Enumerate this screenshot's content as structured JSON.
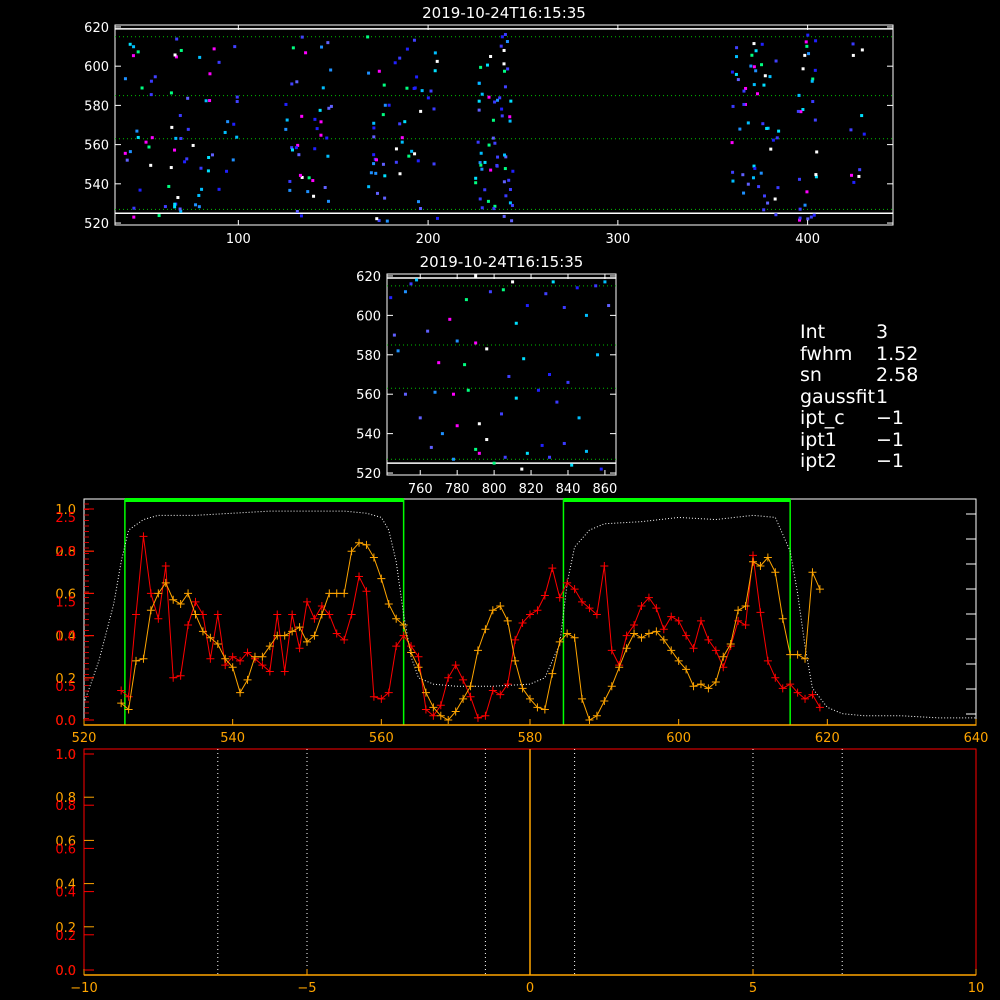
{
  "colors": {
    "axis_white": "#ffffff",
    "axis_orange": "#ffa500",
    "axis_red": "#ff0000",
    "range_green": "#00ff00",
    "grid_green": "#00c000",
    "curve_white": "#ffffff"
  },
  "info_panel": {
    "rows": [
      {
        "label": "Int",
        "value": "3"
      },
      {
        "label": "fwhm",
        "value": "1.52"
      },
      {
        "label": "sn",
        "value": "2.58"
      },
      {
        "label": "gaussfit",
        "value": "1"
      },
      {
        "label": "ipt_c",
        "value": "−1"
      },
      {
        "label": "ipt1",
        "value": "−1"
      },
      {
        "label": "ipt2",
        "value": "−1"
      }
    ]
  },
  "chart_data": [
    {
      "type": "heatmap",
      "title": "2019-10-24T16:15:35",
      "xlim": [
        35,
        445
      ],
      "ylim": [
        519,
        621
      ],
      "xticks": [
        100,
        200,
        300,
        400
      ],
      "yticks": [
        520,
        540,
        560,
        580,
        600,
        620
      ],
      "hlines_white": [
        525,
        619
      ],
      "hlines_green_dotted": [
        527,
        563,
        585,
        615
      ],
      "point_clusters": [
        {
          "x_range": [
            40,
            100
          ],
          "y_range": [
            521,
            617
          ],
          "count": 70
        },
        {
          "x_range": [
            125,
            150
          ],
          "y_range": [
            521,
            617
          ],
          "count": 40
        },
        {
          "x_range": [
            168,
            205
          ],
          "y_range": [
            521,
            617
          ],
          "count": 55
        },
        {
          "x_range": [
            225,
            245
          ],
          "y_range": [
            521,
            617
          ],
          "count": 60
        },
        {
          "x_range": [
            360,
            385
          ],
          "y_range": [
            521,
            617
          ],
          "count": 50
        },
        {
          "x_range": [
            395,
            405
          ],
          "y_range": [
            521,
            617
          ],
          "count": 28
        },
        {
          "x_range": [
            422,
            430
          ],
          "y_range": [
            521,
            617
          ],
          "count": 10
        }
      ]
    },
    {
      "type": "heatmap",
      "title": "2019-10-24T16:15:35",
      "xlim": [
        742,
        866
      ],
      "ylim": [
        519,
        621
      ],
      "xticks": [
        760,
        780,
        800,
        820,
        840,
        860
      ],
      "yticks": [
        520,
        540,
        560,
        580,
        600,
        620
      ],
      "hlines_white": [
        525,
        619
      ],
      "hlines_green_dotted": [
        527,
        563,
        585,
        615
      ],
      "points": [
        [
          744,
          609
        ],
        [
          755,
          616
        ],
        [
          758,
          618
        ],
        [
          764,
          592
        ],
        [
          780,
          587
        ],
        [
          790,
          586
        ],
        [
          805,
          613
        ],
        [
          810,
          617
        ],
        [
          828,
          611
        ],
        [
          832,
          617
        ],
        [
          845,
          614
        ],
        [
          855,
          615
        ],
        [
          860,
          617
        ],
        [
          746,
          590
        ],
        [
          752,
          612
        ],
        [
          776,
          598
        ],
        [
          785,
          608
        ],
        [
          790,
          620
        ],
        [
          798,
          612
        ],
        [
          812,
          596
        ],
        [
          818,
          605
        ],
        [
          838,
          604
        ],
        [
          850,
          600
        ],
        [
          862,
          605
        ],
        [
          748,
          582
        ],
        [
          770,
          576
        ],
        [
          784,
          575
        ],
        [
          796,
          583
        ],
        [
          808,
          569
        ],
        [
          816,
          578
        ],
        [
          830,
          570
        ],
        [
          840,
          566
        ],
        [
          856,
          580
        ],
        [
          752,
          560
        ],
        [
          768,
          561
        ],
        [
          778,
          560
        ],
        [
          786,
          562
        ],
        [
          792,
          545
        ],
        [
          804,
          550
        ],
        [
          812,
          558
        ],
        [
          824,
          562
        ],
        [
          834,
          556
        ],
        [
          846,
          548
        ],
        [
          760,
          548
        ],
        [
          772,
          540
        ],
        [
          780,
          544
        ],
        [
          790,
          532
        ],
        [
          796,
          537
        ],
        [
          806,
          528
        ],
        [
          818,
          530
        ],
        [
          826,
          534
        ],
        [
          838,
          535
        ],
        [
          850,
          531
        ],
        [
          766,
          533
        ],
        [
          778,
          527
        ],
        [
          792,
          530
        ],
        [
          800,
          525
        ],
        [
          815,
          522
        ],
        [
          830,
          528
        ],
        [
          842,
          524
        ],
        [
          858,
          522
        ]
      ]
    },
    {
      "type": "line",
      "xlim": [
        520,
        640
      ],
      "xticks": [
        520,
        540,
        560,
        580,
        600,
        620,
        640
      ],
      "yaxes": [
        {
          "color": "#ffa500",
          "ticks": [
            "0.0",
            "0.2",
            "0.4",
            "0.6",
            "0.8",
            "1.0"
          ]
        },
        {
          "color": "#ff0000",
          "ticks": [
            "0.0",
            "0.5",
            "1.0",
            "1.5",
            "2.0",
            "2.5"
          ]
        }
      ],
      "green_ranges": [
        [
          525.5,
          563
        ],
        [
          584.5,
          615
        ]
      ],
      "series": [
        {
          "color": "#ff0000",
          "marker": "plus",
          "x": [
            525,
            526,
            527,
            528,
            529,
            530,
            531,
            532,
            533,
            534,
            535,
            536,
            537,
            538,
            539,
            540,
            541,
            542,
            543,
            544,
            545,
            546,
            547,
            548,
            549,
            550,
            551,
            552,
            553,
            554,
            555,
            556,
            557,
            558,
            559,
            560,
            561,
            562,
            563,
            564,
            565,
            566,
            567,
            568,
            569,
            570,
            571,
            572,
            573,
            574,
            575,
            576,
            577,
            578,
            579,
            580,
            581,
            582,
            583,
            584,
            585,
            586,
            587,
            588,
            589,
            590,
            591,
            592,
            593,
            594,
            595,
            596,
            597,
            598,
            599,
            600,
            601,
            602,
            603,
            604,
            605,
            606,
            607,
            608,
            609,
            610,
            611,
            612,
            613,
            614,
            615,
            616,
            617,
            618,
            619
          ],
          "y": [
            0.14,
            0.11,
            0.5,
            0.87,
            0.6,
            0.48,
            0.73,
            0.2,
            0.21,
            0.45,
            0.56,
            0.5,
            0.29,
            0.5,
            0.26,
            0.3,
            0.28,
            0.32,
            0.29,
            0.26,
            0.23,
            0.5,
            0.23,
            0.5,
            0.34,
            0.56,
            0.48,
            0.54,
            0.5,
            0.41,
            0.38,
            0.5,
            0.68,
            0.61,
            0.11,
            0.1,
            0.13,
            0.35,
            0.4,
            0.35,
            0.3,
            0.05,
            0.02,
            0.07,
            0.2,
            0.26,
            0.19,
            0.11,
            0.01,
            0.02,
            0.14,
            0.12,
            0.17,
            0.38,
            0.46,
            0.5,
            0.52,
            0.59,
            0.72,
            0.58,
            0.65,
            0.62,
            0.56,
            0.53,
            0.5,
            0.73,
            0.33,
            0.26,
            0.4,
            0.45,
            0.54,
            0.58,
            0.53,
            0.43,
            0.49,
            0.47,
            0.4,
            0.34,
            0.47,
            0.38,
            0.33,
            0.25,
            0.35,
            0.47,
            0.45,
            0.78,
            0.51,
            0.28,
            0.2,
            0.15,
            0.17,
            0.13,
            0.1,
            0.12,
            0.06
          ]
        },
        {
          "color": "#ffa500",
          "marker": "plus",
          "x": [
            525,
            526,
            527,
            528,
            529,
            530,
            531,
            532,
            533,
            534,
            535,
            536,
            537,
            538,
            539,
            540,
            541,
            542,
            543,
            544,
            545,
            546,
            547,
            548,
            549,
            550,
            551,
            552,
            553,
            554,
            555,
            556,
            557,
            558,
            559,
            560,
            561,
            562,
            563,
            564,
            565,
            566,
            567,
            568,
            569,
            570,
            571,
            572,
            573,
            574,
            575,
            576,
            577,
            578,
            579,
            580,
            581,
            582,
            583,
            584,
            585,
            586,
            587,
            588,
            589,
            590,
            591,
            592,
            593,
            594,
            595,
            596,
            597,
            598,
            599,
            600,
            601,
            602,
            603,
            604,
            605,
            606,
            607,
            608,
            609,
            610,
            611,
            612,
            613,
            614,
            615,
            616,
            617,
            618,
            619
          ],
          "y": [
            0.08,
            0.05,
            0.28,
            0.29,
            0.52,
            0.6,
            0.65,
            0.57,
            0.55,
            0.6,
            0.5,
            0.42,
            0.39,
            0.36,
            0.29,
            0.25,
            0.13,
            0.19,
            0.3,
            0.3,
            0.35,
            0.4,
            0.4,
            0.42,
            0.44,
            0.37,
            0.4,
            0.5,
            0.6,
            0.6,
            0.6,
            0.8,
            0.84,
            0.83,
            0.77,
            0.67,
            0.55,
            0.48,
            0.45,
            0.32,
            0.25,
            0.13,
            0.06,
            0.02,
            0.0,
            0.04,
            0.1,
            0.16,
            0.33,
            0.43,
            0.52,
            0.54,
            0.47,
            0.28,
            0.15,
            0.1,
            0.06,
            0.05,
            0.22,
            0.37,
            0.41,
            0.39,
            0.1,
            0.0,
            0.02,
            0.09,
            0.16,
            0.25,
            0.34,
            0.41,
            0.39,
            0.41,
            0.42,
            0.38,
            0.33,
            0.28,
            0.24,
            0.16,
            0.17,
            0.15,
            0.18,
            0.3,
            0.36,
            0.52,
            0.54,
            0.75,
            0.73,
            0.77,
            0.7,
            0.48,
            0.31,
            0.31,
            0.29,
            0.7,
            0.62
          ]
        }
      ],
      "profile_curve": {
        "color": "#ffffff",
        "style": "dotted",
        "x": [
          520,
          522,
          524,
          525,
          526,
          528,
          530,
          535,
          540,
          545,
          550,
          555,
          558,
          560,
          561,
          562,
          563,
          564,
          565,
          567,
          570,
          575,
          580,
          582,
          584,
          585,
          586,
          588,
          590,
          595,
          600,
          605,
          610,
          613,
          615,
          616,
          617,
          618,
          620,
          622,
          625,
          630,
          635,
          640
        ],
        "y": [
          0.08,
          0.28,
          0.55,
          0.75,
          0.9,
          0.95,
          0.97,
          0.97,
          0.98,
          0.99,
          0.99,
          0.99,
          0.98,
          0.96,
          0.9,
          0.75,
          0.5,
          0.3,
          0.2,
          0.17,
          0.16,
          0.16,
          0.17,
          0.2,
          0.36,
          0.65,
          0.82,
          0.9,
          0.93,
          0.94,
          0.96,
          0.95,
          0.97,
          0.96,
          0.8,
          0.6,
          0.35,
          0.15,
          0.06,
          0.03,
          0.02,
          0.02,
          0.01,
          0.01
        ]
      }
    },
    {
      "type": "line",
      "xlim": [
        -10,
        10
      ],
      "ylim": [
        0,
        1
      ],
      "xticks": [
        -10,
        -5,
        0,
        5,
        10
      ],
      "yaxes": [
        {
          "color": "#ffa500",
          "ticks": [
            "0.0",
            "0.2",
            "0.4",
            "0.6",
            "0.8",
            "1.0"
          ]
        },
        {
          "color": "#ff0000",
          "ticks": [
            "0.0",
            "0.2",
            "0.4",
            "0.6",
            "0.8",
            "1.0"
          ]
        }
      ],
      "vlines_dotted_white": [
        -7,
        -5,
        -1,
        1,
        5,
        7
      ],
      "vline_orange": 0
    }
  ]
}
